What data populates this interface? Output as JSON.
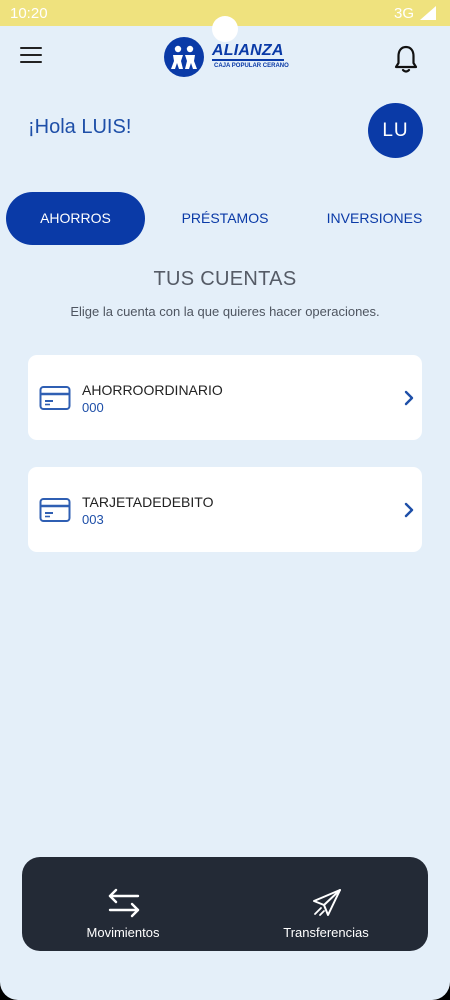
{
  "status_bar": {
    "time": "10:20",
    "network": "3G"
  },
  "header": {
    "logo_word": "ALIANZA",
    "logo_sub": "CAJA POPULAR CERANO",
    "greeting": "¡Hola LUIS!",
    "avatar_initials": "LU"
  },
  "tabs": [
    {
      "label": "AHORROS",
      "active": true
    },
    {
      "label": "PRÉSTAMOS",
      "active": false
    },
    {
      "label": "INVERSIONES",
      "active": false
    }
  ],
  "section": {
    "title": "TUS CUENTAS",
    "subtitle": "Elige la cuenta con la que quieres hacer operaciones."
  },
  "accounts": [
    {
      "name": "AHORROORDINARIO",
      "number": "000"
    },
    {
      "name": "TARJETADEDEBITO",
      "number": "003"
    }
  ],
  "bottom_nav": [
    {
      "label": "Movimientos",
      "icon": "swap-arrows-icon"
    },
    {
      "label": "Transferencias",
      "icon": "paper-plane-icon"
    }
  ],
  "colors": {
    "primary": "#0a3aa7",
    "background": "#e4eff9",
    "status_bar": "#efe27e",
    "bottom_nav": "#232a36"
  }
}
